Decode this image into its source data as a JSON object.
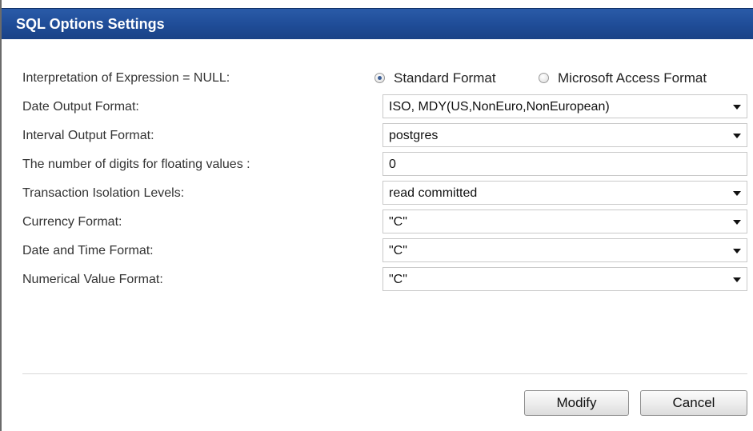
{
  "dialog": {
    "title": "SQL Options Settings"
  },
  "fields": {
    "null_interpretation": {
      "label": "Interpretation of Expression = NULL:",
      "options": [
        {
          "label": "Standard Format",
          "checked": true
        },
        {
          "label": "Microsoft Access Format",
          "checked": false
        }
      ]
    },
    "date_output_format": {
      "label": "Date Output Format:",
      "value": "ISO, MDY(US,NonEuro,NonEuropean)"
    },
    "interval_output_format": {
      "label": "Interval Output Format:",
      "value": "postgres"
    },
    "floating_digits": {
      "label": "The number of digits for floating values :",
      "value": "0"
    },
    "transaction_isolation": {
      "label": "Transaction Isolation Levels:",
      "value": "read committed"
    },
    "currency_format": {
      "label": "Currency Format:",
      "value": "\"C\""
    },
    "date_time_format": {
      "label": "Date and Time Format:",
      "value": "\"C\""
    },
    "numerical_value_format": {
      "label": "Numerical Value Format:",
      "value": "\"C\""
    }
  },
  "buttons": {
    "modify_label": "Modify",
    "cancel_label": "Cancel"
  },
  "colors": {
    "titlebar": "#1f4c97",
    "title_text": "#ffffff",
    "radio_dot": "#3b5e96"
  }
}
